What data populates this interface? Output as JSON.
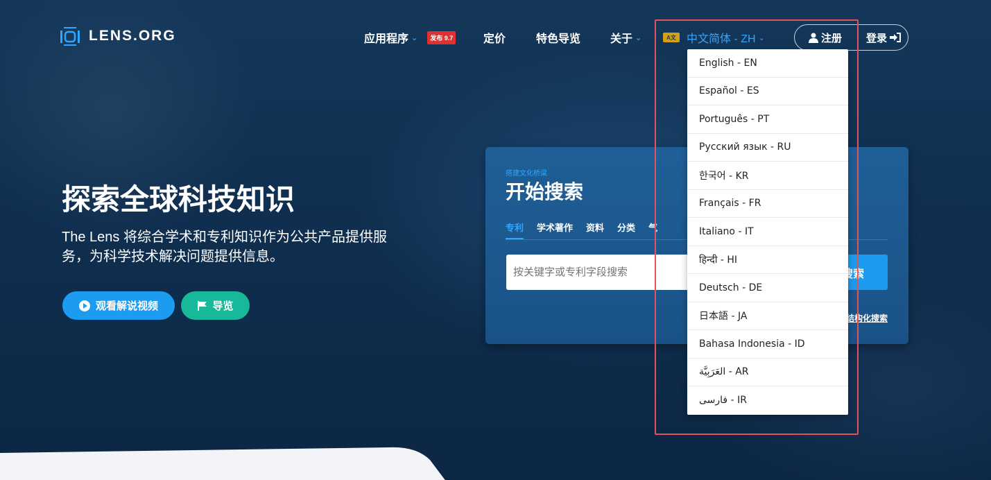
{
  "header": {
    "logo_text": "LENS.ORG",
    "nav": {
      "apps": "应用程序",
      "release_badge": "发布 9.7",
      "pricing": "定价",
      "tour": "特色导览",
      "about": "关于",
      "language": "中文简体 - ZH",
      "language_icon": "A文"
    },
    "signup": "注册",
    "login": "登录"
  },
  "hero": {
    "title": "探索全球科技知识",
    "subtitle": "The Lens 将综合学术和专利知识作为公共产品提供服务，为科学技术解决问题提供信息。",
    "video_button": "观看解说视频",
    "tour_button": "导览"
  },
  "search_card": {
    "kicker": "搭建文化桥梁",
    "title": "开始搜索",
    "tabs": [
      "专利",
      "学术著作",
      "资料",
      "分类",
      "气"
    ],
    "input_placeholder": "按关键字或专利字段搜索",
    "search_button": "搜索",
    "structured_link": "结构化搜索"
  },
  "language_menu": {
    "items": [
      "English - EN",
      "Español - ES",
      "Português - PT",
      "Русский язык - RU",
      "한국어 - KR",
      "Français - FR",
      "Italiano - IT",
      "हिन्दी - HI",
      "Deutsch - DE",
      "日本語 - JA",
      "Bahasa Indonesia - ID",
      "العَرَبِيَّة - AR",
      "فارسی - IR"
    ]
  },
  "colors": {
    "accent": "#2ea7ff",
    "video_button": "#1c9cf0",
    "tour_button": "#17b99a",
    "badge": "#e03131",
    "highlight_border": "#e5525b"
  }
}
